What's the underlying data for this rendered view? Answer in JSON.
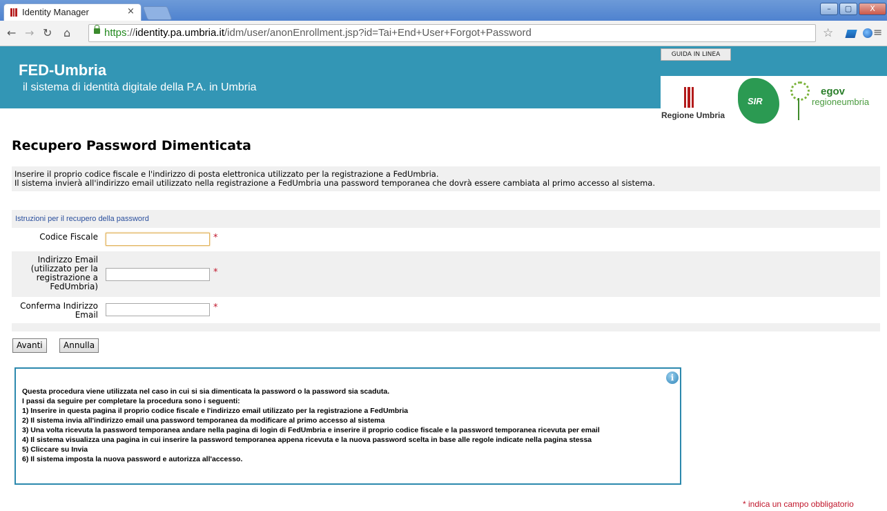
{
  "browser": {
    "tab_title": "Identity Manager",
    "tab_close": "×",
    "url_scheme": "https",
    "url_sep": "://",
    "url_host": "identity.pa.umbria.it",
    "url_path": "/idm/user/anonEnrollment.jsp?id=Tai+End+User+Forgot+Password",
    "win_min": "–",
    "win_max": "▢",
    "win_close": "X"
  },
  "header": {
    "title": "FED-Umbria",
    "subtitle": "il sistema di identità digitale della P.A. in Umbria",
    "help_button": "GUIDA IN LINEA",
    "logo_regione": "Regione Umbria",
    "logo_sir": "SIR",
    "logo_egov": "egov",
    "logo_egov_sub": "regioneumbria"
  },
  "page": {
    "title": "Recupero Password Dimenticata",
    "intro_line1": "Inserire il proprio codice fiscale e l'indirizzo di posta elettronica utilizzato per la registrazione a FedUmbria.",
    "intro_line2": "Il sistema invierà all'indirizzo email utilizzato nella registrazione a FedUmbria una password temporanea che dovrà essere cambiata al primo accesso al sistema.",
    "instructions_link": "Istruzioni per il recupero della password"
  },
  "form": {
    "codice_fiscale_label": "Codice Fiscale",
    "codice_fiscale_value": "",
    "email_label_1": "Indirizzo Email",
    "email_label_2": "(utilizzato per la",
    "email_label_3": "registrazione a",
    "email_label_4": "FedUmbria)",
    "email_value": "",
    "confirm_label_1": "Conferma Indirizzo",
    "confirm_label_2": "Email",
    "confirm_value": "",
    "required_mark": "*",
    "next_button": "Avanti",
    "cancel_button": "Annulla"
  },
  "info": {
    "icon": "i",
    "lines": [
      "Questa procedura viene utilizzata nel caso in cui si sia dimenticata la password o la password sia scaduta.",
      "I passi da seguire per completare la procedura sono i seguenti:",
      "1) Inserire in questa pagina il proprio codice fiscale e l'indirizzo email utilizzato per la registrazione a FedUmbria",
      "2) Il sistema invia all'indirizzo email una password temporanea da modificare al primo accesso al sistema",
      "3) Una volta ricevuta la password temporanea andare nella pagina di login di FedUmbria e inserire il proprio codice fiscale e la password temporanea ricevuta per email",
      "4) Il sistema visualizza una pagina in cui inserire la password temporanea appena ricevuta e la nuova password scelta in base alle regole indicate nella pagina stessa",
      "5) Cliccare su Invia",
      "6) Il sistema imposta la nuova password e autorizza all'accesso."
    ]
  },
  "footnote": {
    "mark": "*",
    "text": "indica un campo obbligatorio"
  },
  "colors": {
    "header_bg": "#3396b5",
    "required_red": "#c0162b",
    "info_border": "#2b88ad",
    "link_blue": "#2a4f9d"
  }
}
